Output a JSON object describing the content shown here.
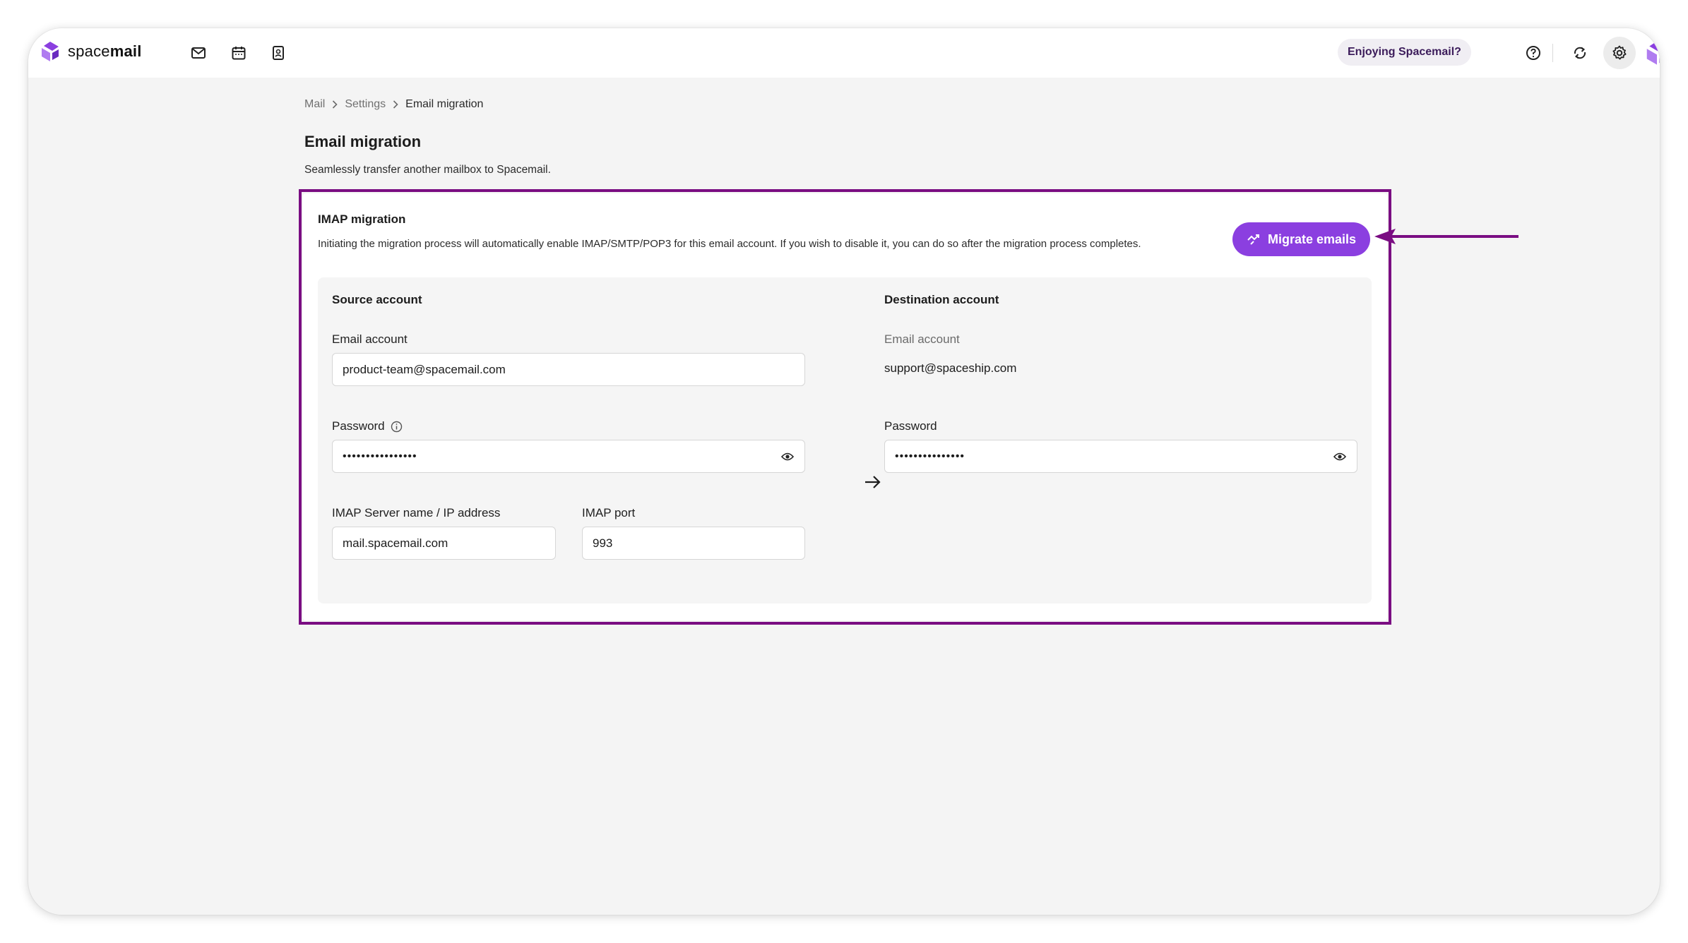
{
  "app": {
    "brand_prefix": "space",
    "brand_suffix": "mail",
    "nav_icons": [
      "mail-icon",
      "calendar-icon",
      "contacts-icon"
    ],
    "feedback_pill": "Enjoying Spacemail?",
    "right_icons": [
      "help-icon",
      "sync-icon",
      "settings-icon",
      "user-avatar"
    ],
    "accent_color": "#8b3fe0"
  },
  "breadcrumb": {
    "items": [
      "Mail",
      "Settings",
      "Email migration"
    ]
  },
  "page": {
    "title": "Email migration",
    "subtitle": "Seamlessly transfer another mailbox to Spacemail."
  },
  "imap": {
    "title": "IMAP migration",
    "description": "Initiating the migration process will automatically enable IMAP/SMTP/POP3 for this email account. If you wish to disable it, you can do so after the migration process completes.",
    "migrate_button": "Migrate emails"
  },
  "source": {
    "title": "Source account",
    "email_label": "Email account",
    "email_value": "product-team@spacemail.com",
    "password_label": "Password",
    "password_value": "••••••••••••••••",
    "server_label": "IMAP Server name / IP address",
    "server_value": "mail.spacemail.com",
    "port_label": "IMAP port",
    "port_value": "993"
  },
  "destination": {
    "title": "Destination account",
    "email_label": "Email account",
    "email_value": "support@spaceship.com",
    "password_label": "Password",
    "password_value": "•••••••••••••••"
  }
}
